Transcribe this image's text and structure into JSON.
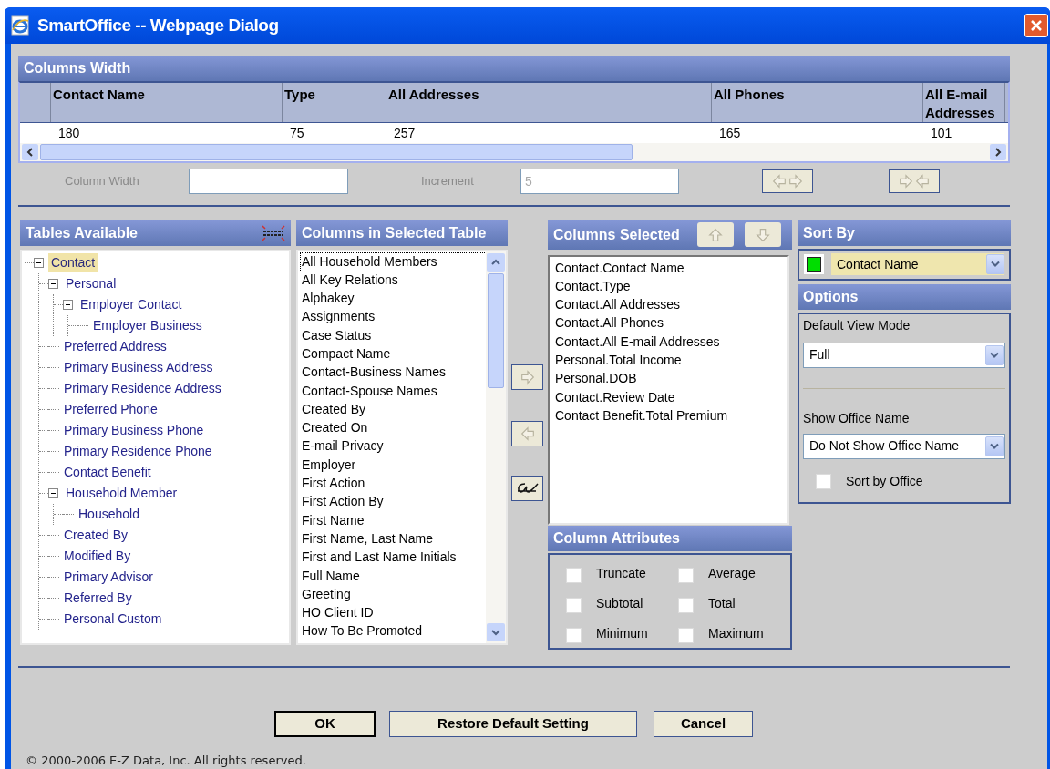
{
  "window": {
    "title": "SmartOffice -- Webpage Dialog"
  },
  "columns_width": {
    "title": "Columns Width",
    "columns": [
      "Contact Name",
      "Type",
      "All Addresses",
      "All Phones",
      "All E-mail Addresses"
    ],
    "row": [
      "180",
      "75",
      "257",
      "165",
      "101"
    ],
    "column_width_label": "Column Width",
    "increment_label": "Increment",
    "increment_value": "5"
  },
  "tables_available": {
    "title": "Tables Available",
    "tree": [
      {
        "label": "Contact",
        "selected": true,
        "expanded": true,
        "children": [
          {
            "label": "Personal",
            "selected": false,
            "expanded": true,
            "children": [
              {
                "label": "Employer Contact",
                "selected": false,
                "expanded": true,
                "children": [
                  {
                    "label": "Employer Business",
                    "selected": false
                  }
                ]
              }
            ]
          },
          {
            "label": "Preferred Address",
            "selected": false
          },
          {
            "label": "Primary Business Address",
            "selected": false
          },
          {
            "label": "Primary Residence Address",
            "selected": false
          },
          {
            "label": "Preferred Phone",
            "selected": false
          },
          {
            "label": "Primary Business Phone",
            "selected": false
          },
          {
            "label": "Primary Residence Phone",
            "selected": false
          },
          {
            "label": "Contact Benefit",
            "selected": false
          },
          {
            "label": "Household Member",
            "selected": false,
            "expanded": true,
            "children": [
              {
                "label": "Household",
                "selected": false
              }
            ]
          },
          {
            "label": "Created By",
            "selected": false
          },
          {
            "label": "Modified By",
            "selected": false
          },
          {
            "label": "Primary Advisor",
            "selected": false
          },
          {
            "label": "Referred By",
            "selected": false
          },
          {
            "label": "Personal Custom",
            "selected": false
          }
        ]
      }
    ]
  },
  "columns_in_table": {
    "title": "Columns in Selected Table",
    "items": [
      {
        "label": "All Household Members",
        "selected": true
      },
      {
        "label": "All Key Relations",
        "selected": false
      },
      {
        "label": "Alphakey",
        "selected": false
      },
      {
        "label": "Assignments",
        "selected": false
      },
      {
        "label": "Case Status",
        "selected": false
      },
      {
        "label": "Compact Name",
        "selected": false
      },
      {
        "label": "Contact-Business Names",
        "selected": false
      },
      {
        "label": "Contact-Spouse Names",
        "selected": false
      },
      {
        "label": "Created By",
        "selected": false
      },
      {
        "label": "Created On",
        "selected": false
      },
      {
        "label": "E-mail Privacy",
        "selected": false
      },
      {
        "label": "Employer",
        "selected": false
      },
      {
        "label": "First Action",
        "selected": false
      },
      {
        "label": "First Action By",
        "selected": false
      },
      {
        "label": "First Name",
        "selected": false
      },
      {
        "label": "First Name, Last Name",
        "selected": false
      },
      {
        "label": "First and Last Name Initials",
        "selected": false
      },
      {
        "label": "Full Name",
        "selected": false
      },
      {
        "label": "Greeting",
        "selected": false
      },
      {
        "label": "HO Client ID",
        "selected": false
      },
      {
        "label": "How To Be Promoted",
        "selected": false
      }
    ]
  },
  "columns_selected": {
    "title": "Columns Selected",
    "items": [
      "Contact.Contact Name",
      "Contact.Type",
      "Contact.All Addresses",
      "Contact.All Phones",
      "Contact.All E-mail Addresses",
      "Personal.Total Income",
      "Personal.DOB",
      "Contact.Review Date",
      "Contact Benefit.Total Premium"
    ]
  },
  "column_attributes": {
    "title": "Column Attributes",
    "items": [
      {
        "label": "Truncate",
        "checked": false
      },
      {
        "label": "Average",
        "checked": false
      },
      {
        "label": "Subtotal",
        "checked": false
      },
      {
        "label": "Total",
        "checked": false
      },
      {
        "label": "Minimum",
        "checked": false
      },
      {
        "label": "Maximum",
        "checked": false
      }
    ]
  },
  "sort_by": {
    "title": "Sort By",
    "value": "Contact Name"
  },
  "options": {
    "title": "Options",
    "default_view_mode": {
      "label": "Default View Mode",
      "value": "Full"
    },
    "show_office_name": {
      "label": "Show Office Name",
      "value": "Do Not Show Office Name"
    },
    "sort_by_office": {
      "label": "Sort by Office",
      "checked": false
    }
  },
  "buttons": [
    {
      "label": "OK",
      "default": true
    },
    {
      "label": "Restore Default Setting",
      "default": false
    },
    {
      "label": "Cancel",
      "default": false
    }
  ],
  "footer": "© 2000-2006 E-Z Data, Inc. All rights reserved."
}
